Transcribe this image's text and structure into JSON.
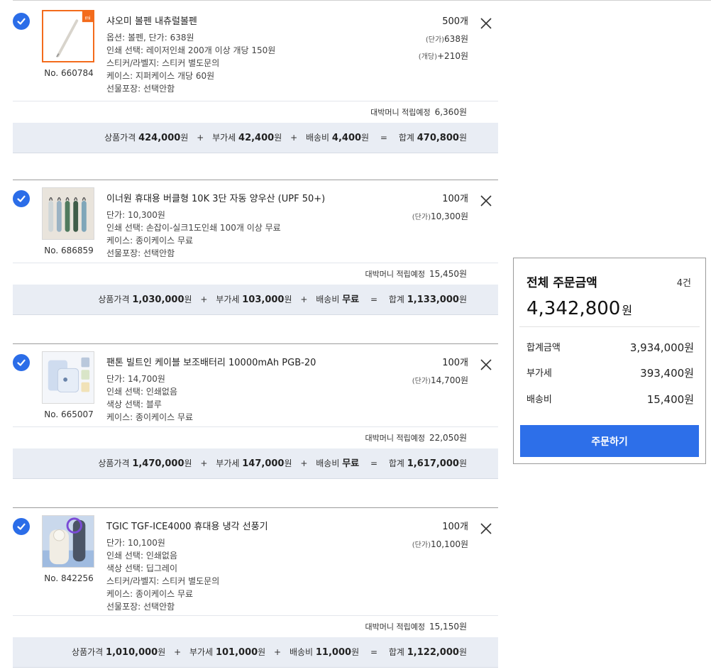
{
  "items": [
    {
      "name": "샤오미 볼펜 내츄럴볼펜",
      "product_no": "No. 660784",
      "options": [
        "옵션: 볼펜, 단가: 638원",
        "인쇄 선택: 레이저인쇄 200개 이상 개당 150원",
        "스티커/라벨지: 스티커 별도문의",
        "케이스: 지퍼케이스 개당 60원",
        "선물포장: 선택안함"
      ],
      "quantity": "500개",
      "prices": [
        {
          "tag": "(단가)",
          "value": "638원"
        },
        {
          "tag": "(개당)",
          "value": "+210원"
        }
      ],
      "points_label": "대박머니 적립예정",
      "points_value": "6,360원",
      "product_label": "상품가격",
      "product_price": "424,000",
      "vat_label": "부가세",
      "vat": "42,400",
      "ship_label": "배송비",
      "ship": "4,400",
      "total_label": "합계",
      "total": "470,800",
      "won": "원",
      "plus": "+",
      "equals": "=",
      "thumb": "pen-icon"
    },
    {
      "name": "이너원 휴대용 버클형 10K 3단 자동 양우산 (UPF 50+)",
      "product_no": "No. 686859",
      "options": [
        "단가: 10,300원",
        "인쇄 선택: 손잡이-실크1도인쇄 100개 이상 무료",
        "케이스: 종이케이스 무료",
        "선물포장: 선택안함"
      ],
      "quantity": "100개",
      "prices": [
        {
          "tag": "(단가)",
          "value": "10,300원"
        }
      ],
      "points_label": "대박머니 적립예정",
      "points_value": "15,450원",
      "product_label": "상품가격",
      "product_price": "1,030,000",
      "vat_label": "부가세",
      "vat": "103,000",
      "ship_label": "배송비",
      "ship": "무료",
      "total_label": "합계",
      "total": "1,133,000",
      "won": "원",
      "plus": "+",
      "equals": "=",
      "thumb": "umbrella-icon"
    },
    {
      "name": "팬톤 빌트인 케이블 보조배터리 10000mAh PGB-20",
      "product_no": "No. 665007",
      "options": [
        "단가: 14,700원",
        "인쇄 선택: 인쇄없음",
        "색상 선택: 블루",
        "케이스: 종이케이스 무료"
      ],
      "quantity": "100개",
      "prices": [
        {
          "tag": "(단가)",
          "value": "14,700원"
        }
      ],
      "points_label": "대박머니 적립예정",
      "points_value": "22,050원",
      "product_label": "상품가격",
      "product_price": "1,470,000",
      "vat_label": "부가세",
      "vat": "147,000",
      "ship_label": "배송비",
      "ship": "무료",
      "total_label": "합계",
      "total": "1,617,000",
      "won": "원",
      "plus": "+",
      "equals": "=",
      "thumb": "battery-icon"
    },
    {
      "name": "TGIC TGF-ICE4000 휴대용 냉각 선풍기",
      "product_no": "No. 842256",
      "options": [
        "단가: 10,100원",
        "인쇄 선택: 인쇄없음",
        "색상 선택: 딥그레이",
        "스티커/라벨지: 스티커 별도문의",
        "케이스: 종이케이스 무료",
        "선물포장: 선택안함"
      ],
      "quantity": "100개",
      "prices": [
        {
          "tag": "(단가)",
          "value": "10,100원"
        }
      ],
      "points_label": "대박머니 적립예정",
      "points_value": "15,150원",
      "product_label": "상품가격",
      "product_price": "1,010,000",
      "vat_label": "부가세",
      "vat": "101,000",
      "ship_label": "배송비",
      "ship": "11,000",
      "total_label": "합계",
      "total": "1,122,000",
      "won": "원",
      "plus": "+",
      "equals": "=",
      "thumb": "fan-icon"
    }
  ],
  "summary": {
    "title": "전체 주문금액",
    "count": "4건",
    "grand_total": "4,342,800",
    "grand_unit": "원",
    "subtotal_label": "합계금액",
    "subtotal": "3,934,000원",
    "vat_label": "부가세",
    "vat": "393,400원",
    "ship_label": "배송비",
    "ship": "15,400원",
    "order_button": "주문하기"
  },
  "colors": {
    "accent": "#2d6fe9",
    "check": "#2b6de8",
    "totals_bg": "#e9edf4",
    "brand_orange": "#f36b1c"
  }
}
